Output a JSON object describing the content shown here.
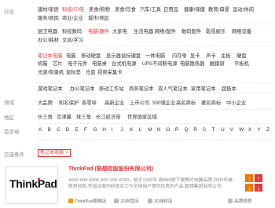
{
  "labels": {
    "hangye": "行业",
    "lingyu": "领域",
    "diqu": "地区",
    "shouzimu": "首字母",
    "yixuan": "已选条件"
  },
  "industry_row1": [
    "建材/家居",
    "科技/IT/电",
    "美食/购物",
    "美食/饮食",
    "汽车/工具",
    "日用品",
    "健康/保健",
    "教育/母婴",
    "运动/休闲"
  ],
  "industry_row1b": [
    "服务/居民",
    "商业/企业",
    "城市/地区"
  ],
  "industry_row2": [
    "厨卫电器",
    "科技数码",
    "电脑/硬件",
    "大家电",
    "生活电器",
    "网络/配件",
    "数码配件",
    "影视娱乐",
    "网络设备"
  ],
  "industry_row2b": [
    "办公/耗材",
    "文具/学习"
  ],
  "sub_row1": [
    "笔记本电脑",
    "电脑",
    "移动硬盘",
    "显示器",
    "鼠标键盘",
    "一体电脑",
    "内存条",
    "显卡",
    "声卡",
    "主板",
    "硬盘"
  ],
  "sub_row2": [
    "机箱",
    "芯片",
    "电子元件",
    "电脑桌",
    "台式机电源",
    "UPS不间断电源",
    "电脑散热器",
    "触摸屏",
    "平板机"
  ],
  "sub_row3": [
    "光驱/刻录机",
    "鼠标垫",
    "光盘",
    "视频采集卡"
  ],
  "sub_row4": [
    "游戏笔记本",
    "办公笔记本",
    "移动工作站",
    "商务笔记本",
    "双人气笔记本",
    "家用笔记本",
    "超极本"
  ],
  "domain_items": [
    "大品牌",
    "知名保护",
    "各零导",
    "高新企业",
    "上市公司",
    "500强企业",
    "高名商标",
    "著名商标",
    "中小企业"
  ],
  "region_items": [
    "长三角",
    "京津冀",
    "珠三角",
    "长江经济带",
    "世界国家区域"
  ],
  "letters": [
    "A",
    "B",
    "C",
    "D",
    "E",
    "F",
    "G",
    "H",
    "I",
    "J",
    "K",
    "L",
    "M",
    "N",
    "O",
    "P",
    "Q",
    "R",
    "S",
    "T",
    "U",
    "V",
    "W",
    "X",
    "Y",
    "Z"
  ],
  "selected_tag": "笔记本电脑",
  "brand": {
    "name": "ThinkPad",
    "company": "(联想控股股份有限公司)",
    "logo_main": "ThinkPad",
    "desc": "4000-888-9006,400-100-6000，始于1992年,原IBM旗下便携式电脑品牌,2005年被联想收购,凭借深厚的研发实力为全球用户提供优秀的产品,联想集团有限公司",
    "chips": [
      "ThinkPad旗舰店",
      "JD自营店",
      "JD授权店"
    ],
    "chip_right": "品牌资质"
  }
}
